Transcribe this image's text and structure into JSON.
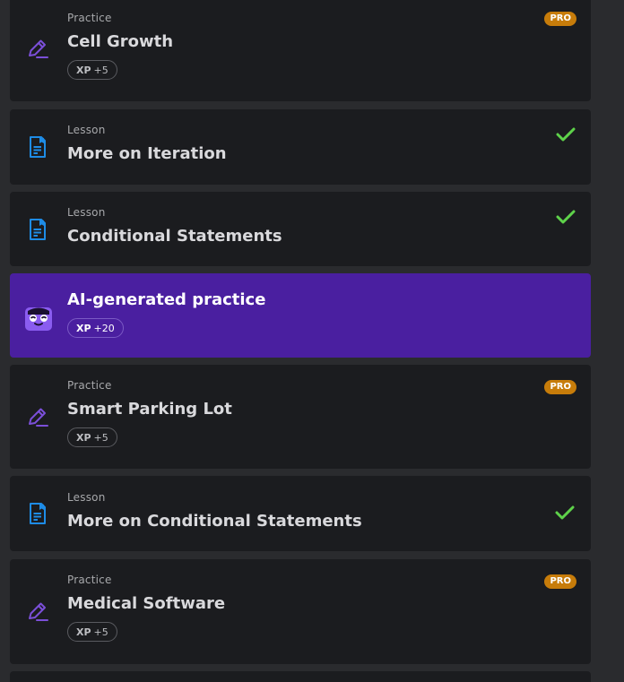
{
  "colors": {
    "background": "#2a2b2e",
    "card": "#1b1c1f",
    "ai_card": "#4a1fa0",
    "pro_badge": "#c77c0a",
    "check": "#5ed24a",
    "lesson_icon": "#1e8ce6",
    "practice_icon": "#7b4fd8"
  },
  "items": [
    {
      "type": "Practice",
      "title": "Cell Growth",
      "xp_label": "XP",
      "xp_value": "+5",
      "pro": "PRO",
      "icon": "pencil-icon"
    },
    {
      "type": "Lesson",
      "title": "More on Iteration",
      "completed": true,
      "icon": "lesson-doc-icon"
    },
    {
      "type": "Lesson",
      "title": "Conditional Statements",
      "completed": true,
      "icon": "lesson-doc-icon"
    },
    {
      "type": "",
      "title": "AI-generated practice",
      "xp_label": "XP",
      "xp_value": "+20",
      "icon": "ai-bot-icon"
    },
    {
      "type": "Practice",
      "title": "Smart Parking Lot",
      "xp_label": "XP",
      "xp_value": "+5",
      "pro": "PRO",
      "icon": "pencil-icon"
    },
    {
      "type": "Lesson",
      "title": "More on Conditional Statements",
      "completed": true,
      "icon": "lesson-doc-icon"
    },
    {
      "type": "Practice",
      "title": "Medical Software",
      "xp_label": "XP",
      "xp_value": "+5",
      "pro": "PRO",
      "icon": "pencil-icon"
    }
  ]
}
